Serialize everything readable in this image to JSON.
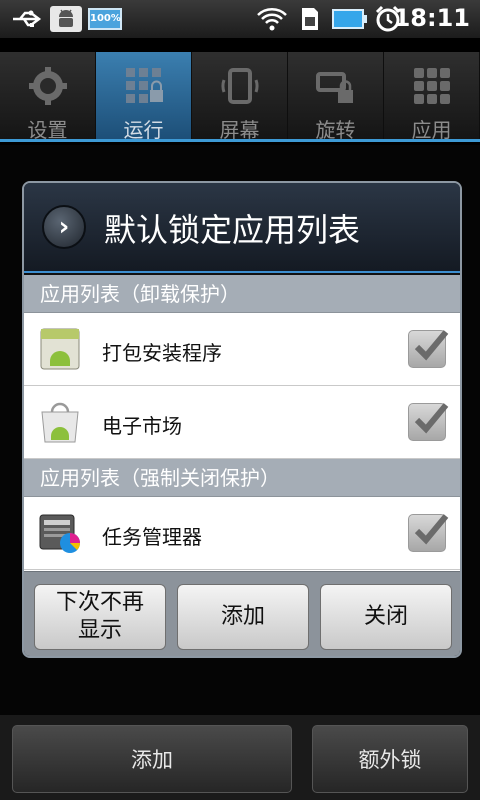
{
  "status_bar": {
    "time": "18:11",
    "battery_text": "100%",
    "icons": [
      "usb-icon",
      "android-debug-icon",
      "battery-full-icon",
      "wifi-icon",
      "sim-icon",
      "battery-icon",
      "alarm-icon"
    ]
  },
  "tabs": [
    {
      "label": "设置",
      "icon": "gear-icon",
      "active": false
    },
    {
      "label": "运行",
      "icon": "grid-lock-icon",
      "active": true
    },
    {
      "label": "屏幕",
      "icon": "screen-rotate-icon",
      "active": false
    },
    {
      "label": "旋转",
      "icon": "rotate-lock-icon",
      "active": false
    },
    {
      "label": "应用",
      "icon": "apps-grid-icon",
      "active": false
    }
  ],
  "dialog": {
    "title": "默认锁定应用列表",
    "sections": [
      {
        "header": "应用列表（卸载保护）",
        "items": [
          {
            "label": "打包安装程序",
            "icon": "package-installer-icon",
            "checked": true
          },
          {
            "label": "电子市场",
            "icon": "market-bag-icon",
            "checked": true
          }
        ]
      },
      {
        "header": "应用列表（强制关闭保护）",
        "items": [
          {
            "label": "任务管理器",
            "icon": "task-manager-icon",
            "checked": true
          }
        ]
      }
    ],
    "buttons": {
      "dont_show": "下次不再\n显示",
      "add": "添加",
      "close": "关闭"
    }
  },
  "bottom_bar": {
    "add": "添加",
    "extra_lock": "额外锁"
  },
  "colors": {
    "accent": "#3e8fd0",
    "section_bg": "#a5adb6",
    "active_tab": "#2f6f9f"
  }
}
